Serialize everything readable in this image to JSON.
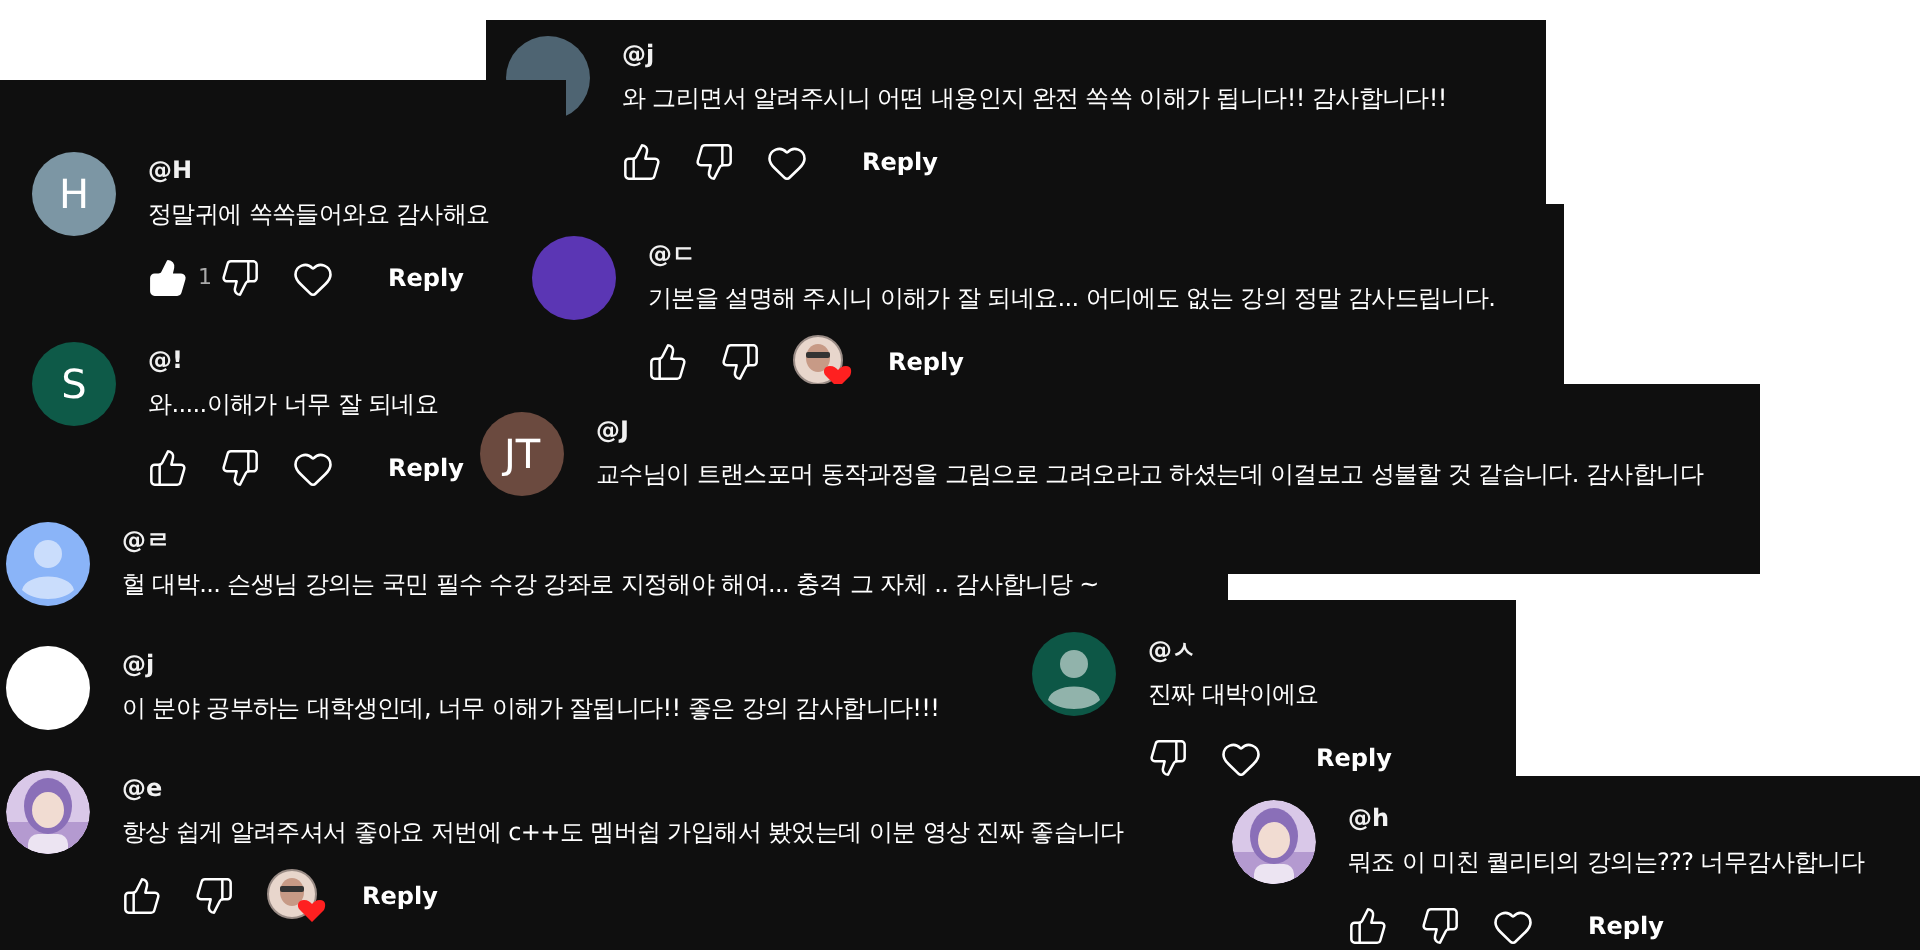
{
  "panels": [
    {
      "comments": [
        {
          "avatar": {
            "kind": "plain",
            "color": "#4e6472"
          },
          "username": "@j",
          "text": "와 그리면서 알려주시니 어떤 내용인지 완전 쏙쏙 이해가 됩니다!! 감사합니다!!",
          "actions": [
            {
              "kind": "like",
              "filled": false
            },
            {
              "kind": "dislike"
            },
            {
              "kind": "heart"
            },
            {
              "kind": "reply",
              "label": "Reply"
            }
          ]
        }
      ]
    },
    {
      "comments": [
        {
          "avatar": {
            "kind": "initial",
            "letter": "H",
            "color": "#7c96a4"
          },
          "username": "@H",
          "text": "정말귀에 쏙쏙들어와요 감사해요",
          "actions": [
            {
              "kind": "like",
              "filled": true,
              "count": "1"
            },
            {
              "kind": "dislike"
            },
            {
              "kind": "heart"
            },
            {
              "kind": "reply",
              "label": "Reply"
            }
          ]
        },
        {
          "avatar": {
            "kind": "initial",
            "letter": "S",
            "color": "#0e5a48"
          },
          "username": "@!",
          "text": "와.....이해가 너무 잘 되네요",
          "actions": [
            {
              "kind": "like",
              "filled": false
            },
            {
              "kind": "dislike"
            },
            {
              "kind": "heart"
            },
            {
              "kind": "reply",
              "label": "Reply"
            }
          ]
        }
      ]
    },
    {
      "comments": [
        {
          "avatar": {
            "kind": "plain",
            "color": "#5b36b4"
          },
          "username": "@ㄷ",
          "text": "기본을 설명해 주시니 이해가 잘 되네요... 어디에도 없는 강의 정말 감사드립니다.",
          "actions": [
            {
              "kind": "like",
              "filled": false
            },
            {
              "kind": "dislike"
            },
            {
              "kind": "creator-heart"
            },
            {
              "kind": "reply",
              "label": "Reply"
            }
          ]
        }
      ]
    },
    {
      "comments": [
        {
          "avatar": {
            "kind": "initial",
            "letter": "JT",
            "color": "#6b4a3f"
          },
          "username": "@J",
          "text": "교수님이 트랜스포머 동작과정을 그림으로 그려오라고 하셨는데 이걸보고 성불할 것 같습니다. 감사합니다"
        }
      ]
    },
    {
      "comments": [
        {
          "avatar": {
            "kind": "silhouette",
            "color": "#8ab4f8"
          },
          "username": "@ㄹ",
          "text": "헐 대박... 슨생님 강의는 국민 필수 수강 강좌로 지정해야 해여... 충격 그 자체 .. 감사합니당 ~"
        },
        {
          "avatar": {
            "kind": "blank"
          },
          "username": "@j",
          "text": "이 분야 공부하는 대학생인데, 너무 이해가 잘됩니다!! 좋은 강의 감사합니다!!!"
        },
        {
          "username": "@e",
          "text": "항상 쉽게 알려주셔서 좋아요 저번에 c++도 멤버쉽 가입해서 봤었는데 이분 영상 진짜 좋습니다",
          "actions": [
            {
              "kind": "like",
              "filled": false
            },
            {
              "kind": "dislike"
            },
            {
              "kind": "creator-heart"
            },
            {
              "kind": "reply",
              "label": "Reply"
            }
          ]
        }
      ]
    },
    {
      "comments": [
        {
          "avatar": {
            "kind": "silhouette",
            "color": "#0d5746"
          },
          "username": "@ㅅ",
          "text": "진짜 대박이에요",
          "actions": [
            {
              "kind": "dislike"
            },
            {
              "kind": "heart"
            },
            {
              "kind": "reply",
              "label": "Reply"
            }
          ]
        }
      ]
    },
    {
      "comments": [
        {
          "username": "@h",
          "text": "뭐죠 이 미친 퀄리티의 강의는??? 너무감사합니다",
          "actions": [
            {
              "kind": "like",
              "filled": false
            },
            {
              "kind": "dislike"
            },
            {
              "kind": "heart"
            },
            {
              "kind": "reply",
              "label": "Reply"
            }
          ]
        }
      ]
    }
  ]
}
